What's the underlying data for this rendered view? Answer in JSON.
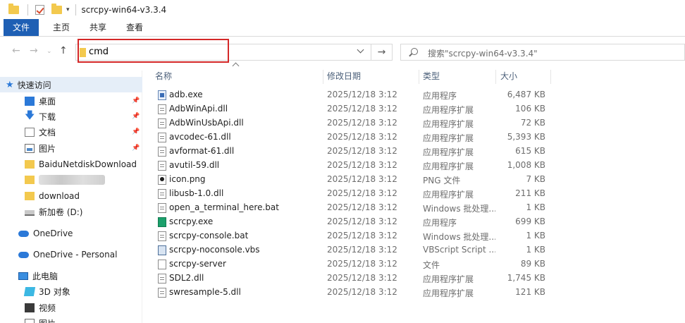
{
  "window": {
    "title": "scrcpy-win64-v3.3.4"
  },
  "ribbon": {
    "tabs": [
      "文件",
      "主页",
      "共享",
      "查看"
    ]
  },
  "address": {
    "value": "cmd",
    "search_placeholder": "搜索\"scrcpy-win64-v3.3.4\""
  },
  "sidebar": {
    "quick_access": "快速访问",
    "items": [
      {
        "label": "桌面",
        "icon": "desktop-icon",
        "pinned": true
      },
      {
        "label": "下载",
        "icon": "download-arrow-icon",
        "pinned": true
      },
      {
        "label": "文档",
        "icon": "document-icon",
        "pinned": true
      },
      {
        "label": "图片",
        "icon": "pictures-icon",
        "pinned": true
      },
      {
        "label": "BaiduNetdiskDownload",
        "icon": "folder-icon",
        "pinned": false
      },
      {
        "label": "",
        "icon": "folder-icon",
        "pinned": false
      },
      {
        "label": "download",
        "icon": "folder-icon",
        "pinned": false
      },
      {
        "label": "新加卷 (D:)",
        "icon": "drive-icon",
        "pinned": false
      }
    ],
    "onedrive": "OneDrive",
    "onedrive_personal": "OneDrive - Personal",
    "this_pc": "此电脑",
    "pc_items": [
      {
        "label": "3D 对象",
        "icon": "3d-objects-icon"
      },
      {
        "label": "视频",
        "icon": "video-icon"
      },
      {
        "label": "图片",
        "icon": "pictures-icon"
      }
    ]
  },
  "columns": {
    "name": "名称",
    "date": "修改日期",
    "type": "类型",
    "size": "大小"
  },
  "files": [
    {
      "name": "adb.exe",
      "date": "2025/12/18 3:12",
      "type": "应用程序",
      "size": "6,487 KB",
      "icon": "exe"
    },
    {
      "name": "AdbWinApi.dll",
      "date": "2025/12/18 3:12",
      "type": "应用程序扩展",
      "size": "106 KB",
      "icon": "dll"
    },
    {
      "name": "AdbWinUsbApi.dll",
      "date": "2025/12/18 3:12",
      "type": "应用程序扩展",
      "size": "72 KB",
      "icon": "dll"
    },
    {
      "name": "avcodec-61.dll",
      "date": "2025/12/18 3:12",
      "type": "应用程序扩展",
      "size": "5,393 KB",
      "icon": "dll"
    },
    {
      "name": "avformat-61.dll",
      "date": "2025/12/18 3:12",
      "type": "应用程序扩展",
      "size": "615 KB",
      "icon": "dll"
    },
    {
      "name": "avutil-59.dll",
      "date": "2025/12/18 3:12",
      "type": "应用程序扩展",
      "size": "1,008 KB",
      "icon": "dll"
    },
    {
      "name": "icon.png",
      "date": "2025/12/18 3:12",
      "type": "PNG 文件",
      "size": "7 KB",
      "icon": "png"
    },
    {
      "name": "libusb-1.0.dll",
      "date": "2025/12/18 3:12",
      "type": "应用程序扩展",
      "size": "211 KB",
      "icon": "dll"
    },
    {
      "name": "open_a_terminal_here.bat",
      "date": "2025/12/18 3:12",
      "type": "Windows 批处理...",
      "size": "1 KB",
      "icon": "bat"
    },
    {
      "name": "scrcpy.exe",
      "date": "2025/12/18 3:12",
      "type": "应用程序",
      "size": "699 KB",
      "icon": "scr"
    },
    {
      "name": "scrcpy-console.bat",
      "date": "2025/12/18 3:12",
      "type": "Windows 批处理...",
      "size": "1 KB",
      "icon": "bat"
    },
    {
      "name": "scrcpy-noconsole.vbs",
      "date": "2025/12/18 3:12",
      "type": "VBScript Script ...",
      "size": "1 KB",
      "icon": "vbs"
    },
    {
      "name": "scrcpy-server",
      "date": "2025/12/18 3:12",
      "type": "文件",
      "size": "89 KB",
      "icon": "file"
    },
    {
      "name": "SDL2.dll",
      "date": "2025/12/18 3:12",
      "type": "应用程序扩展",
      "size": "1,745 KB",
      "icon": "dll"
    },
    {
      "name": "swresample-5.dll",
      "date": "2025/12/18 3:12",
      "type": "应用程序扩展",
      "size": "121 KB",
      "icon": "dll"
    }
  ]
}
